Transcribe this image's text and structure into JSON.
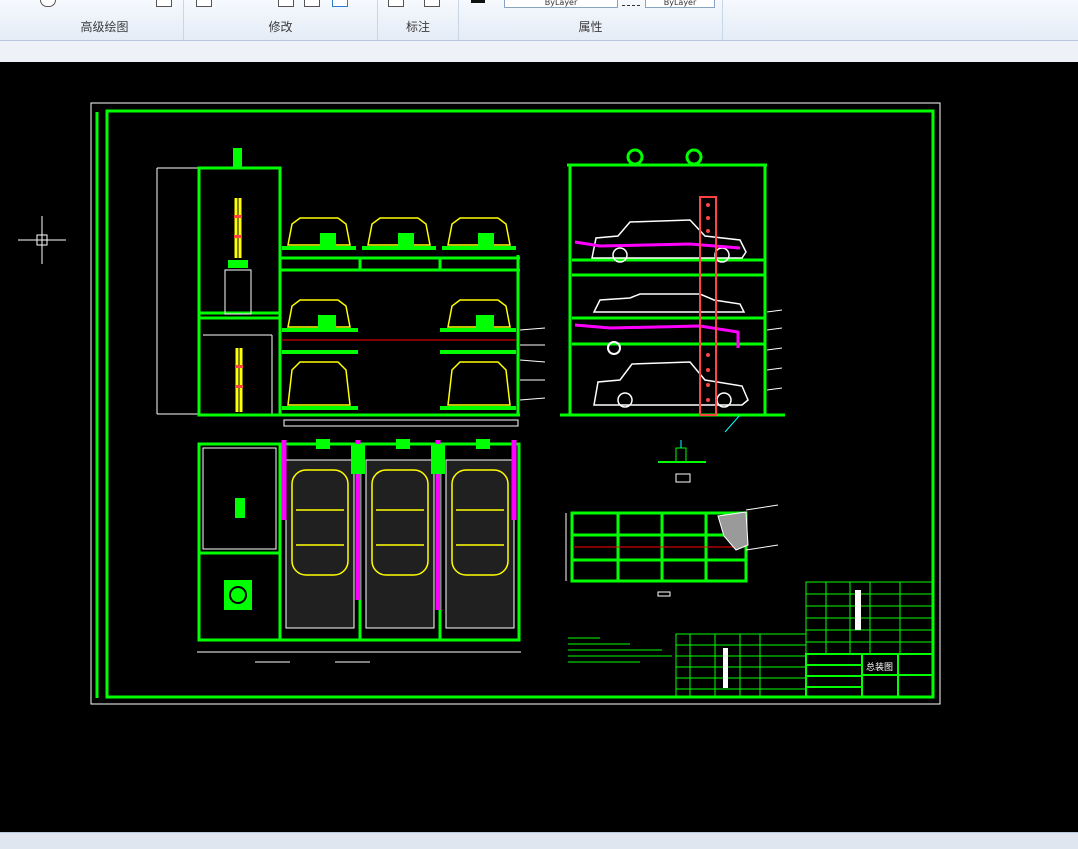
{
  "ribbon": {
    "panels": [
      {
        "label": "高级绘图"
      },
      {
        "label": "修改"
      },
      {
        "label": "标注"
      },
      {
        "label": "属性"
      }
    ],
    "properties": {
      "layer_value": "ByLayer",
      "linetype_value": "ByLayer"
    }
  },
  "drawing": {
    "title_block_name": "总装图",
    "colors": {
      "background": "#000000",
      "frame": "#00ff00",
      "detail": "#ffff00",
      "hydraulic": "#ff00ff",
      "dimension": "#00ffff",
      "center_line": "#ff0000"
    }
  }
}
